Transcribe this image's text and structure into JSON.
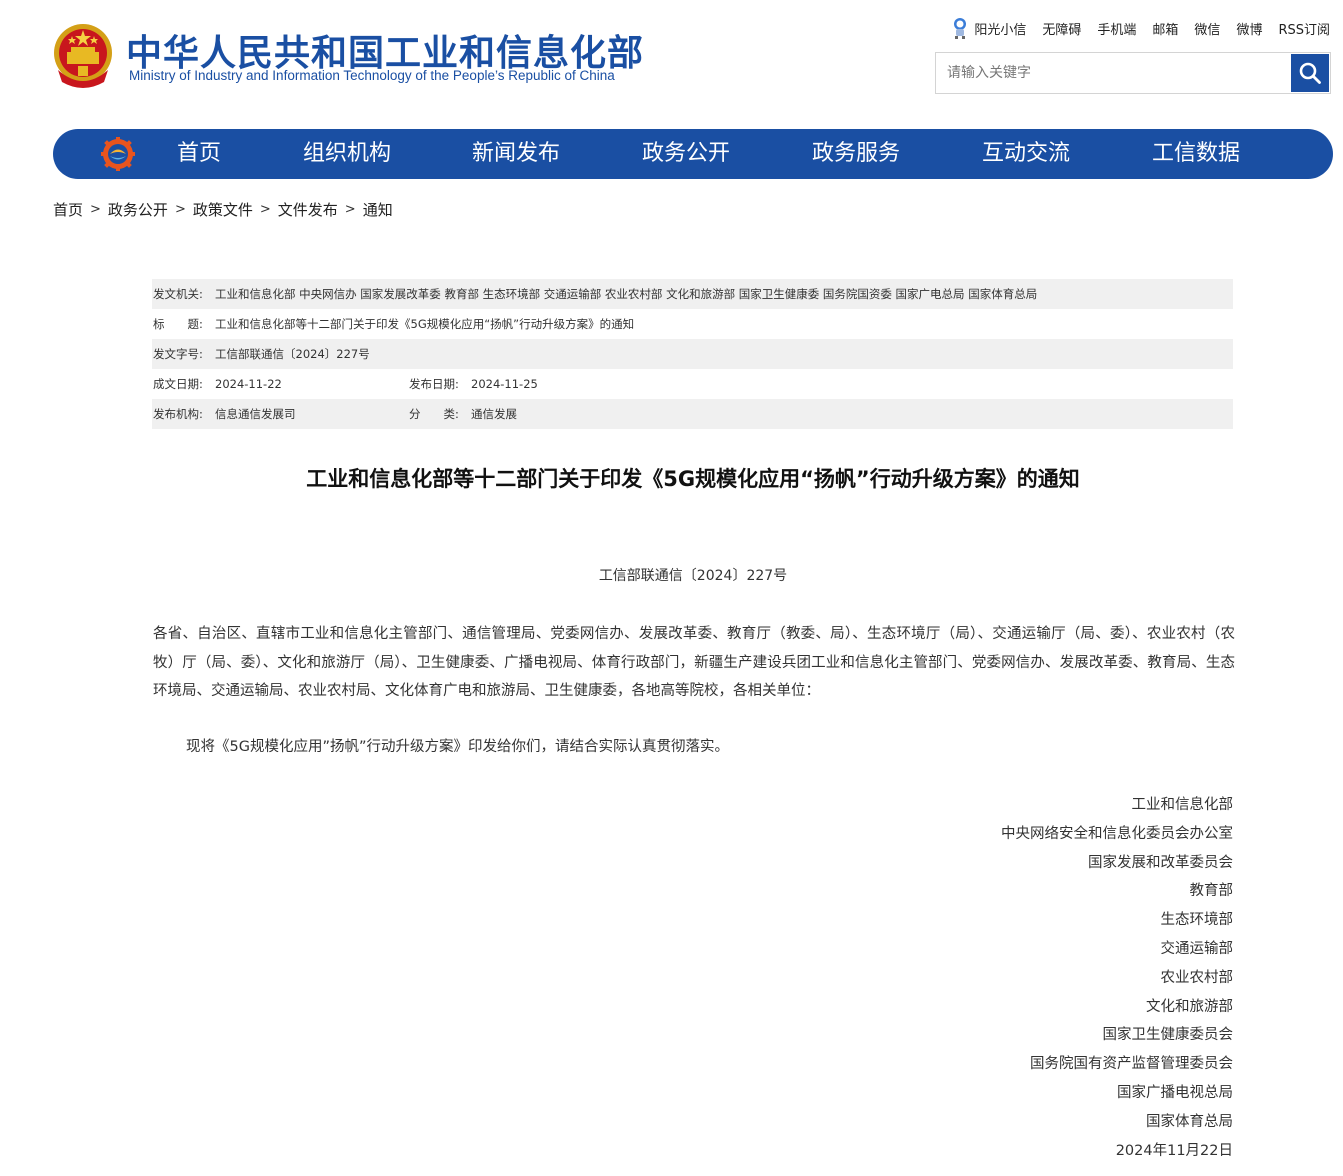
{
  "header": {
    "title": "中华人民共和国工业和信息化部",
    "subtitle": "Ministry of Industry and Information Technology of the People’s Republic of China",
    "top_links": [
      "阳光小信",
      "无障碍",
      "手机端",
      "邮箱",
      "微信",
      "微博",
      "RSS订阅"
    ],
    "search_placeholder": "请输入关键字"
  },
  "nav": {
    "items": [
      "首页",
      "组织机构",
      "新闻发布",
      "政务公开",
      "政务服务",
      "互动交流",
      "工信数据"
    ]
  },
  "breadcrumb": [
    "首页",
    "政务公开",
    "政策文件",
    "文件发布",
    "通知"
  ],
  "meta": {
    "issuer_label": "发文机关:",
    "issuer": "工业和信息化部 中央网信办 国家发展改革委 教育部 生态环境部 交通运输部 农业农村部 文化和旅游部 国家卫生健康委 国务院国资委 国家广电总局 国家体育总局",
    "title_label": "标　　题:",
    "title": "工业和信息化部等十二部门关于印发《5G规模化应用“扬帆”行动升级方案》的通知",
    "docno_label": "发文字号:",
    "docno": "工信部联通信〔2024〕227号",
    "date_label": "成文日期:",
    "date": "2024-11-22",
    "pubdate_label": "发布日期:",
    "pubdate": "2024-11-25",
    "org_label": "发布机构:",
    "org": "信息通信发展司",
    "category_label": "分　　类:",
    "category": "通信发展"
  },
  "article": {
    "title": "工业和信息化部等十二部门关于印发《5G规模化应用“扬帆”行动升级方案》的通知",
    "doc_number": "工信部联通信〔2024〕227号",
    "addressees": "各省、自治区、直辖市工业和信息化主管部门、通信管理局、党委网信办、发展改革委、教育厅（教委、局）、生态环境厅（局）、交通运输厅（局、委）、农业农村（农牧）厅（局、委）、文化和旅游厅（局）、卫生健康委、广播电视局、体育行政部门，新疆生产建设兵团工业和信息化主管部门、党委网信办、发展改革委、教育局、生态环境局、交通运输局、农业农村局、文化体育广电和旅游局、卫生健康委，各地高等院校，各相关单位：",
    "body": "现将《5G规模化应用”扬帆”行动升级方案》印发给你们，请结合实际认真贯彻落实。",
    "signers": [
      "工业和信息化部",
      "中央网络安全和信息化委员会办公室",
      "国家发展和改革委员会",
      "教育部",
      "生态环境部",
      "交通运输部",
      "农业农村部",
      "文化和旅游部",
      "国家卫生健康委员会",
      "国务院国有资产监督管理委员会",
      "国家广播电视总局",
      "国家体育总局"
    ],
    "date": "2024年11月22日"
  },
  "colors": {
    "brand_blue": "#1a4fa3",
    "meta_shade": "#f0f0f0"
  }
}
